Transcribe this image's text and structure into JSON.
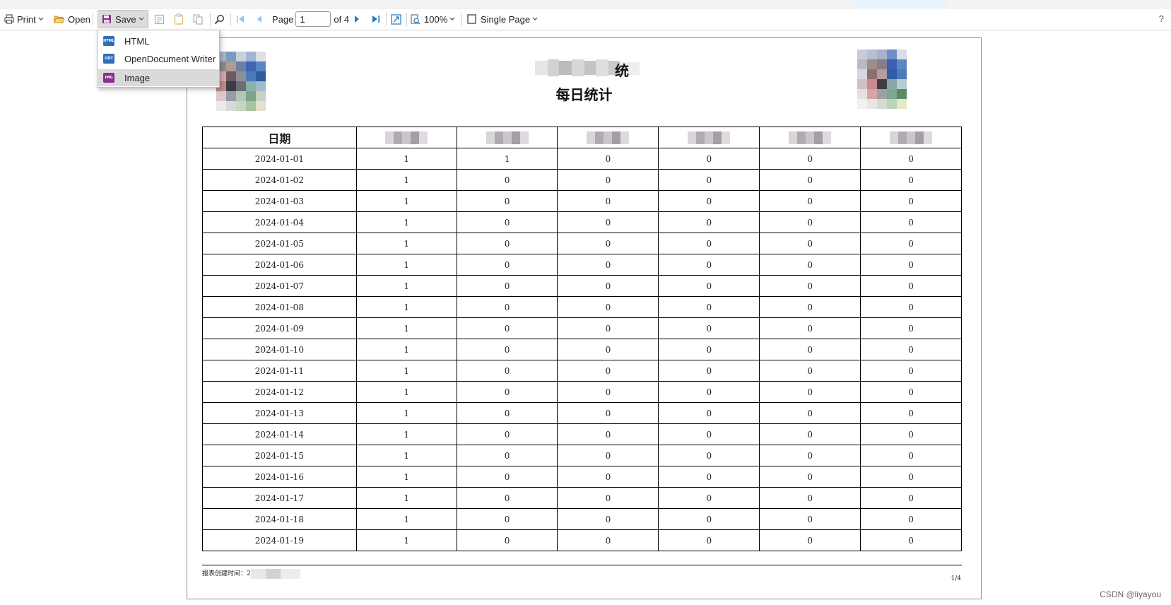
{
  "toolbar": {
    "print_label": "Print",
    "open_label": "Open",
    "save_label": "Save",
    "page_label": "Page",
    "page_value": "1",
    "of_label": "of 4",
    "zoom_label": "100%",
    "view_label": "Single Page",
    "help_label": "?"
  },
  "save_menu": {
    "items": [
      {
        "label": "HTML",
        "icon_text": "HTML"
      },
      {
        "label": "OpenDocument Writer",
        "icon_text": "ODT"
      },
      {
        "label": "Image",
        "icon_text": "IMG"
      }
    ]
  },
  "report": {
    "title_line1_partial": "统",
    "title_line2": "每日统计",
    "columns": [
      "日期",
      "",
      "",
      "",
      "",
      "",
      ""
    ],
    "rows": [
      [
        "2024-01-01",
        "1",
        "1",
        "0",
        "0",
        "0",
        "0"
      ],
      [
        "2024-01-02",
        "1",
        "0",
        "0",
        "0",
        "0",
        "0"
      ],
      [
        "2024-01-03",
        "1",
        "0",
        "0",
        "0",
        "0",
        "0"
      ],
      [
        "2024-01-04",
        "1",
        "0",
        "0",
        "0",
        "0",
        "0"
      ],
      [
        "2024-01-05",
        "1",
        "0",
        "0",
        "0",
        "0",
        "0"
      ],
      [
        "2024-01-06",
        "1",
        "0",
        "0",
        "0",
        "0",
        "0"
      ],
      [
        "2024-01-07",
        "1",
        "0",
        "0",
        "0",
        "0",
        "0"
      ],
      [
        "2024-01-08",
        "1",
        "0",
        "0",
        "0",
        "0",
        "0"
      ],
      [
        "2024-01-09",
        "1",
        "0",
        "0",
        "0",
        "0",
        "0"
      ],
      [
        "2024-01-10",
        "1",
        "0",
        "0",
        "0",
        "0",
        "0"
      ],
      [
        "2024-01-11",
        "1",
        "0",
        "0",
        "0",
        "0",
        "0"
      ],
      [
        "2024-01-12",
        "1",
        "0",
        "0",
        "0",
        "0",
        "0"
      ],
      [
        "2024-01-13",
        "1",
        "0",
        "0",
        "0",
        "0",
        "0"
      ],
      [
        "2024-01-14",
        "1",
        "0",
        "0",
        "0",
        "0",
        "0"
      ],
      [
        "2024-01-15",
        "1",
        "0",
        "0",
        "0",
        "0",
        "0"
      ],
      [
        "2024-01-16",
        "1",
        "0",
        "0",
        "0",
        "0",
        "0"
      ],
      [
        "2024-01-17",
        "1",
        "0",
        "0",
        "0",
        "0",
        "0"
      ],
      [
        "2024-01-18",
        "1",
        "0",
        "0",
        "0",
        "0",
        "0"
      ],
      [
        "2024-01-19",
        "1",
        "0",
        "0",
        "0",
        "0",
        "0"
      ]
    ],
    "footer_created": "报表创建时间：2",
    "footer_page": "1/4"
  },
  "watermark": "CSDN @liyayou",
  "colors": {
    "save_icon": "#8b2d8f",
    "print_icon": "#555555",
    "folder_icon": "#e0a020",
    "nav_icon": "#1e7bc4",
    "menu_highlight": "#dadada"
  }
}
